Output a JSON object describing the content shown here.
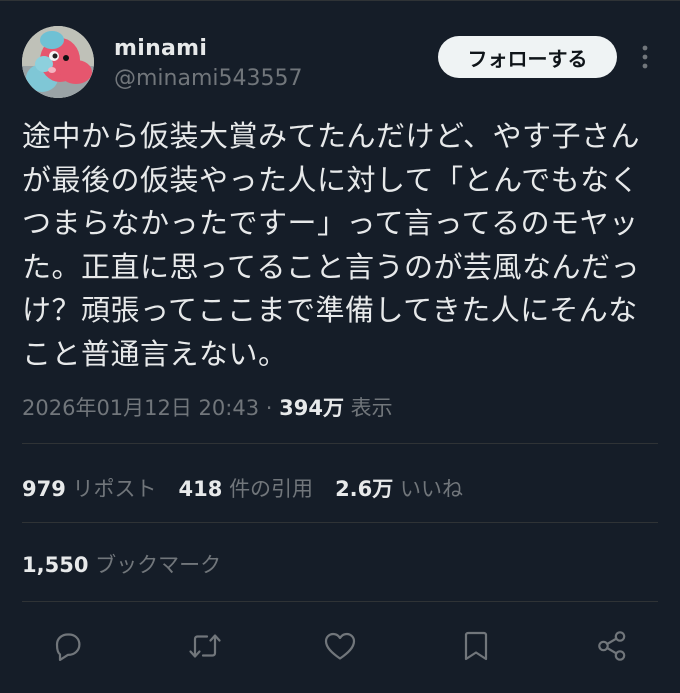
{
  "user": {
    "name": "minami",
    "handle": "@minami543557",
    "follow_label": "フォローする"
  },
  "tweet": {
    "text": "途中から仮装大賞みてたんだけど、やす子さんが最後の仮装やった人に対して「とんでもなくつまらなかったですー」って言ってるのモヤッた。正直に思ってること言うのが芸風なんだっけ？頑張ってここまで準備してきた人にそんなこと普通言えない。",
    "timestamp": "2026年01月12日 20:43",
    "separator": " · ",
    "views_count": "394万",
    "views_label": "表示"
  },
  "stats": {
    "reposts_count": "979",
    "reposts_label": "リポスト",
    "quotes_count": "418",
    "quotes_label": "件の引用",
    "likes_count": "2.6万",
    "likes_label": "いいね",
    "bookmarks_count": "1,550",
    "bookmarks_label": "ブックマーク"
  },
  "actions": {
    "icons": [
      "reply-icon",
      "repost-icon",
      "like-icon",
      "bookmark-icon",
      "share-icon"
    ]
  },
  "colors": {
    "background": "#151d28",
    "text_primary": "#e7e9ea",
    "text_secondary": "#71767b",
    "divider": "#2f3336",
    "follow_button_bg": "#eff3f4"
  }
}
